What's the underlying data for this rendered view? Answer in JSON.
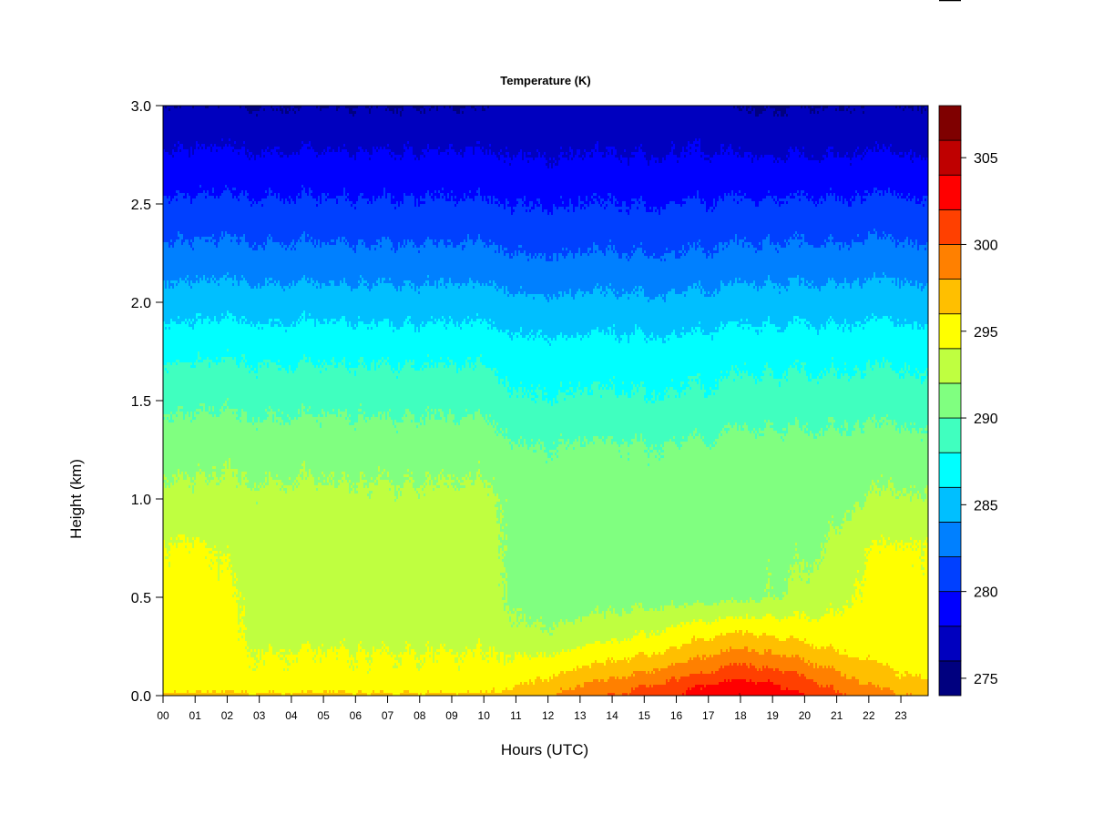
{
  "chart_data": {
    "type": "heatmap",
    "title": "Temperature (K)",
    "xlabel": "Hours (UTC)",
    "ylabel": "Height (km)",
    "xlim": [
      0,
      23.85
    ],
    "ylim": [
      0,
      3.0
    ],
    "x_ticks": [
      0,
      1,
      2,
      3,
      4,
      5,
      6,
      7,
      8,
      9,
      10,
      11,
      12,
      13,
      14,
      15,
      16,
      17,
      18,
      19,
      20,
      21,
      22,
      23
    ],
    "x_tick_labels": [
      "00",
      "01",
      "02",
      "03",
      "04",
      "05",
      "06",
      "07",
      "08",
      "09",
      "10",
      "11",
      "12",
      "13",
      "14",
      "15",
      "16",
      "17",
      "18",
      "19",
      "20",
      "21",
      "22",
      "23"
    ],
    "y_ticks": [
      0,
      0.5,
      1.0,
      1.5,
      2.0,
      2.5,
      3.0
    ],
    "y_tick_labels": [
      "0.0",
      "0.5",
      "1.0",
      "1.5",
      "2.0",
      "2.5",
      "3.0"
    ],
    "colorbar": {
      "levels": [
        274,
        276,
        278,
        280,
        282,
        284,
        286,
        288,
        290,
        292,
        294,
        296,
        298,
        300,
        302,
        304,
        306,
        308
      ],
      "colors": [
        "#00007F",
        "#0000BF",
        "#0000FF",
        "#0040FF",
        "#0080FF",
        "#00BFFF",
        "#00FFFF",
        "#40FFBF",
        "#80FF80",
        "#BFFF40",
        "#FFFF00",
        "#FFBF00",
        "#FF8000",
        "#FF4000",
        "#FF0000",
        "#BF0000",
        "#7F0000"
      ],
      "ticks": [
        275,
        280,
        285,
        290,
        295,
        300,
        305
      ],
      "tick_labels": [
        "275",
        "280",
        "285",
        "290",
        "295",
        "300",
        "305"
      ]
    },
    "grid_hours": [
      0,
      1,
      2,
      3,
      4,
      5,
      6,
      7,
      8,
      9,
      10,
      11,
      12,
      13,
      14,
      15,
      16,
      17,
      18,
      19,
      20,
      21,
      22,
      23,
      24
    ],
    "grid_heights_km": [
      0,
      0.05,
      0.1,
      0.2,
      0.3,
      0.5,
      0.75,
      1.0,
      1.25,
      1.5,
      1.75,
      2.0,
      2.25,
      2.5,
      2.75,
      3.0
    ],
    "temperature_K": [
      [
        296.5,
        296.5,
        296.5,
        296.5,
        296.5,
        296.5,
        296.5,
        296.5,
        296.5,
        296.5,
        296.5,
        297,
        298,
        299,
        300,
        301,
        302,
        303,
        304,
        303.5,
        302,
        300.5,
        299,
        298,
        298
      ],
      [
        295,
        295,
        295,
        295,
        295,
        295,
        295,
        295,
        295,
        295,
        295,
        296,
        297,
        298,
        299,
        300,
        301,
        302,
        303,
        302.5,
        301,
        299.5,
        298,
        297,
        297
      ],
      [
        294.5,
        294.5,
        294.5,
        294.5,
        294.5,
        294.5,
        294.5,
        294.5,
        294.5,
        294.5,
        294.5,
        295,
        296,
        297,
        297.5,
        298.5,
        299.5,
        300.5,
        301.5,
        301,
        300,
        298.5,
        297,
        296,
        296
      ],
      [
        294.5,
        294.5,
        294.5,
        294.2,
        294.2,
        294.2,
        294.2,
        294.2,
        294.2,
        294.2,
        294.2,
        294,
        294.3,
        294.8,
        295.5,
        296.2,
        297,
        298,
        299,
        298.5,
        297.5,
        296.5,
        295.5,
        295,
        295
      ],
      [
        294.5,
        294.5,
        294.5,
        293.5,
        293.5,
        293.5,
        293.5,
        293.5,
        293.5,
        293.5,
        293.5,
        292.5,
        292.5,
        293,
        293.5,
        294.2,
        295,
        295.8,
        296.5,
        296,
        295.5,
        295,
        294.8,
        294.8,
        294.8
      ],
      [
        294.5,
        294.6,
        294.3,
        293.2,
        293.2,
        293.2,
        293.2,
        293.2,
        293.2,
        293.2,
        293.2,
        291.5,
        291,
        291,
        291,
        291.2,
        291.2,
        291.2,
        291.5,
        292,
        292.5,
        293.5,
        294.5,
        294.6,
        294.6
      ],
      [
        294.2,
        294.2,
        293.5,
        293,
        293,
        293,
        293,
        293,
        293,
        293,
        293,
        291.5,
        290.8,
        290.8,
        290.8,
        290.8,
        290.8,
        290.8,
        291.5,
        291.5,
        291.5,
        292.5,
        293.8,
        294.2,
        294.2
      ],
      [
        292.5,
        292.5,
        292.5,
        292.5,
        292.5,
        292.5,
        292.5,
        292.5,
        292.5,
        292.5,
        292.5,
        291.5,
        291,
        291,
        291,
        291,
        291,
        291,
        291.3,
        291.3,
        291.3,
        291.3,
        292,
        292.2,
        292.2
      ],
      [
        291.2,
        291.2,
        291.2,
        291.2,
        291.2,
        291.2,
        291.2,
        291.2,
        291.2,
        291.2,
        291.2,
        290.3,
        290.3,
        290.3,
        290.3,
        290.3,
        290.3,
        290.3,
        290.8,
        290.8,
        290.8,
        290.8,
        290.8,
        290.8,
        290.8
      ],
      [
        289.5,
        289.5,
        289.5,
        289.5,
        289.5,
        289.5,
        289.5,
        289.5,
        289.5,
        289.5,
        289.5,
        288.3,
        288.3,
        288.3,
        288.3,
        288.3,
        288.3,
        288.3,
        289,
        289,
        289,
        289,
        289,
        289,
        289
      ],
      [
        287.5,
        287.5,
        287.5,
        287.5,
        287.5,
        287.5,
        287.5,
        287.5,
        287.5,
        287.5,
        287.5,
        286.8,
        286.8,
        286.8,
        286.8,
        286.8,
        286.8,
        286.8,
        287.3,
        287.3,
        287.3,
        287.3,
        287.3,
        287.3,
        287.3
      ],
      [
        285,
        285,
        285,
        285,
        285,
        285,
        285,
        285,
        285,
        285,
        285,
        284.5,
        284.5,
        284.5,
        284.5,
        284.5,
        284.5,
        284.5,
        285,
        285,
        285,
        285,
        285,
        285,
        285
      ],
      [
        282.5,
        282.5,
        282.5,
        282.5,
        282.5,
        282.5,
        282.5,
        282.5,
        282.5,
        282.5,
        282.5,
        282,
        282,
        282,
        282,
        282,
        282,
        282,
        282.5,
        282.5,
        282.5,
        282.5,
        282.5,
        282.5,
        282.5
      ],
      [
        280.3,
        280.3,
        280.3,
        280.3,
        280.3,
        280.3,
        280.3,
        280.3,
        280.3,
        280.3,
        280.3,
        280,
        280,
        280,
        280,
        280,
        280,
        280,
        280.3,
        280.3,
        280.3,
        280.3,
        280.3,
        280.3,
        280.3
      ],
      [
        278.2,
        278.2,
        278.2,
        278.2,
        278.2,
        278.2,
        278.2,
        278.2,
        278.2,
        278.2,
        278.2,
        278,
        278,
        278,
        278,
        278,
        278,
        278,
        278,
        278,
        278,
        278,
        278,
        278,
        278
      ],
      [
        276,
        276,
        276,
        276,
        276,
        276,
        276,
        276,
        276,
        276,
        276,
        276.5,
        276.5,
        276.5,
        276.5,
        276.5,
        276.5,
        276.5,
        275.8,
        275.8,
        276,
        276,
        276,
        276,
        276
      ]
    ]
  }
}
